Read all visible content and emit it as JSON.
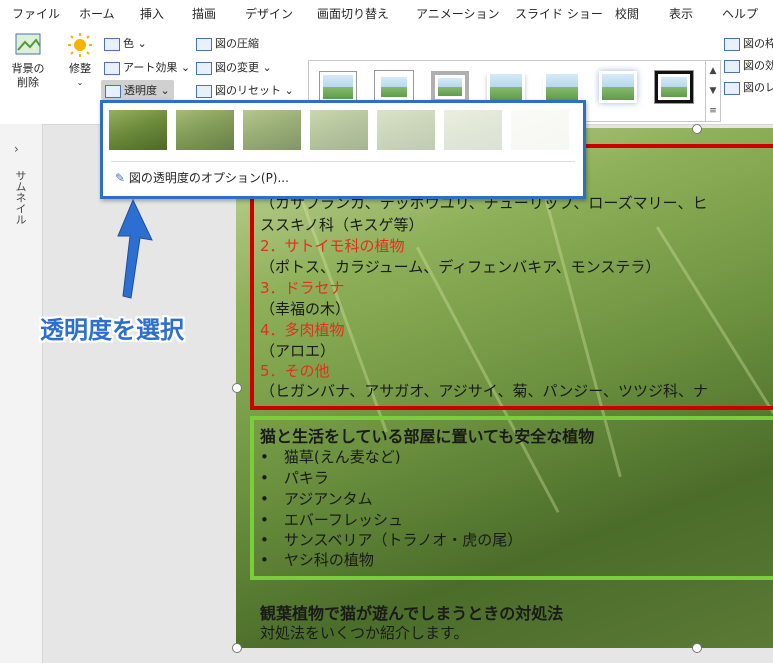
{
  "menu": {
    "tabs": [
      "ファイル",
      "ホーム",
      "挿入",
      "描画",
      "デザイン",
      "画面切り替え",
      "アニメーション",
      "スライド ショー",
      "校閲",
      "表示",
      "ヘルプ"
    ]
  },
  "ribbon": {
    "remove_bg": "背景の\n削除",
    "corrections": "修整",
    "color": "色",
    "artistic_effects": "アート効果",
    "transparency": "透明度",
    "compress": "図の圧縮",
    "change": "図の変更",
    "reset": "図のリセット",
    "border_partial": "図の枠",
    "effects_partial": "図の効",
    "layout_partial": "図のレ"
  },
  "left_pane": {
    "label": "サムネイル",
    "expand_glyph": "›"
  },
  "transparency_menu": {
    "presets": [
      0,
      15,
      30,
      50,
      65,
      80,
      95
    ],
    "option_label": "図の透明度のオプション(P)..."
  },
  "annotation": "透明度を選択",
  "slide": {
    "line1": "（カサブランカ、テッポウユリ、チューリップ、ローズマリー、ヒ",
    "line2": "ススキノ科（キスゲ等）",
    "line3": "2．サトイモ科の植物",
    "line4": "（ポトス、カラジューム、ディフェンバキア、モンステラ）",
    "line5": "3．ドラセナ",
    "line6": "（幸福の木）",
    "line7": "4．多肉植物",
    "line8": "（アロエ）",
    "line9": "5．その他",
    "line10": "（ヒガンバナ、アサガオ、アジサイ、菊、パンジー、ツツジ科、ナ",
    "safe_title": "猫と生活をしている部屋に置いても安全な植物",
    "safe_items": [
      "•　猫草(えん麦など)",
      "•　パキラ",
      "•　アジアンタム",
      "•　エバーフレッシュ",
      "•　サンスベリア（トラノオ・虎の尾）",
      "•　ヤシ科の植物"
    ],
    "foliage_title": "観葉植物で猫が遊んでしまうときの対処法",
    "foliage_body": "対処法をいくつか紹介します。"
  }
}
